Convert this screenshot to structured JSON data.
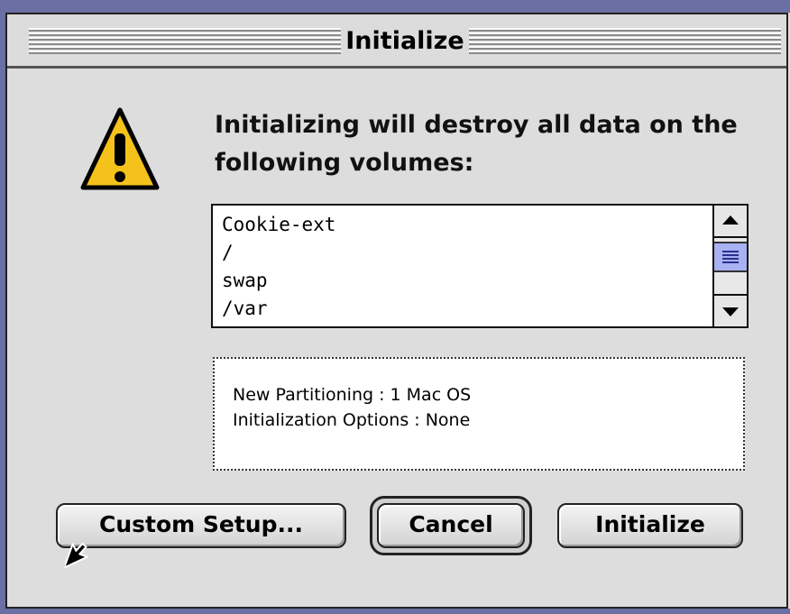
{
  "window": {
    "title": "Initialize"
  },
  "dialog": {
    "icon": "warning-icon",
    "message": "Initializing will destroy all data on the following volumes:",
    "volumes": [
      "Cookie-ext",
      "/",
      "swap",
      "/var"
    ],
    "info": {
      "line1": "New Partitioning : 1 Mac OS",
      "line2": "Initialization Options : None"
    }
  },
  "buttons": {
    "custom_setup": "Custom Setup...",
    "cancel": "Cancel",
    "initialize": "Initialize"
  },
  "colors": {
    "scroll_thumb": "#a8b2f2",
    "warning_fill": "#f5c21b",
    "desktop": "#6b6fa3"
  }
}
